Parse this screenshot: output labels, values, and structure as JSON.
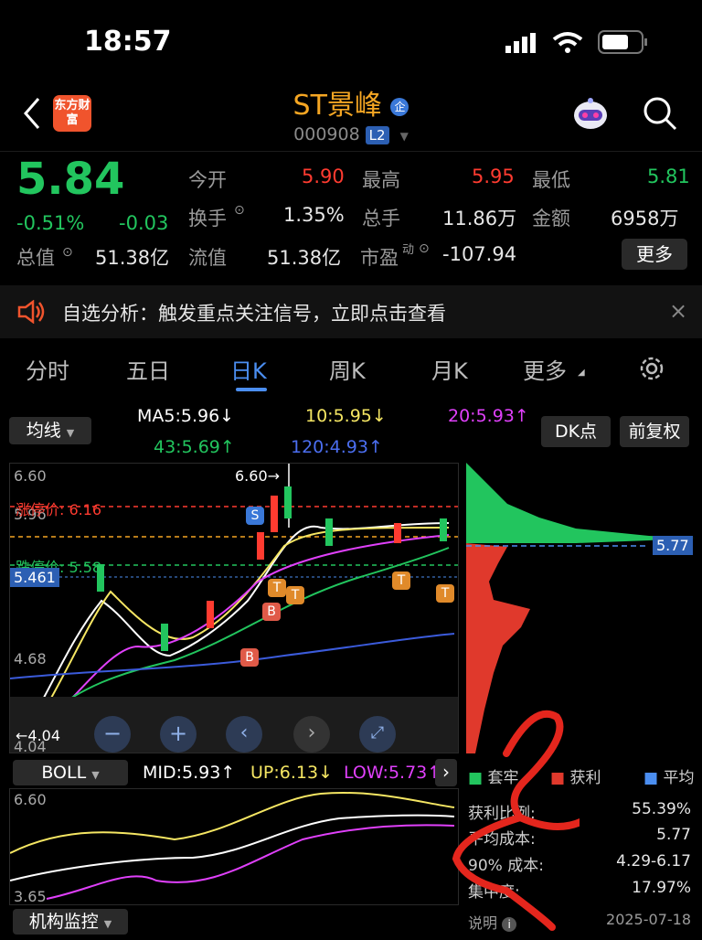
{
  "status": {
    "time": "18:57"
  },
  "header": {
    "app_logo_text": "东方财富",
    "title": "ST景峰",
    "title_badge": "企",
    "code": "000908",
    "level_badge": "L2"
  },
  "quote": {
    "price": "5.84",
    "change_pct": "-0.51%",
    "change": "-0.03",
    "open_label": "今开",
    "open": "5.90",
    "high_label": "最高",
    "high": "5.95",
    "low_label": "最低",
    "low": "5.81",
    "turnover_label": "换手",
    "turnover": "1.35%",
    "volume_label": "总手",
    "volume": "11.86万",
    "amount_label": "金额",
    "amount": "6958万",
    "mcap_label": "总值",
    "mcap": "51.38亿",
    "float_label": "流值",
    "float": "51.38亿",
    "pe_label": "市盈",
    "pe_sup": "动",
    "pe": "-107.94",
    "more_label": "更多"
  },
  "notice": {
    "text": "自选分析：触发重点关注信号，立即点击查看"
  },
  "tabs": [
    "分时",
    "五日",
    "日K",
    "周K",
    "月K",
    "更多"
  ],
  "active_tab": "日K",
  "indicators": {
    "ma_select": "均线",
    "ma5": "MA5:5.96↓",
    "ma10": "10:5.95↓",
    "ma20": "20:5.93↑",
    "ma43": "43:5.69↑",
    "ma120": "120:4.93↑",
    "dk_button": "DK点",
    "adjust_button": "前复权"
  },
  "kline": {
    "y_top": "6.60",
    "y_high_mark": "5.96",
    "limit_up": "涨停价: 6.16",
    "limit_down": "跌停价: 5.58",
    "cursor_price": "5.461",
    "y_mid": "4.68",
    "y_bottom": "4.04",
    "max_label": "6.60→",
    "min_label": "←4.04"
  },
  "boll": {
    "select": "BOLL",
    "mid": "MID:5.93↑",
    "up": "UP:6.13↓",
    "low": "LOW:5.73↑",
    "y_top": "6.60",
    "y_bottom": "3.65"
  },
  "bottom": {
    "select": "机构监控"
  },
  "chips": {
    "price_tag": "5.77",
    "legend_trapped": "套牢",
    "legend_profit": "获利",
    "legend_avg": "平均",
    "profit_ratio_label": "获利比例:",
    "profit_ratio": "55.39%",
    "avg_cost_label": "平均成本:",
    "avg_cost": "5.77",
    "cost90_label": "90% 成本:",
    "cost90": "4.29-6.17",
    "concentration_label": "集中度:",
    "concentration": "17.97%",
    "explain_label": "说明",
    "date": "2025-07-18"
  },
  "colors": {
    "up": "#ff3b30",
    "down": "#22c55e",
    "accent": "#4b8ef0",
    "brand": "#f5a623",
    "ma10": "#f5e663",
    "ma20": "#e040fb",
    "ma120": "#3b5bdb"
  }
}
